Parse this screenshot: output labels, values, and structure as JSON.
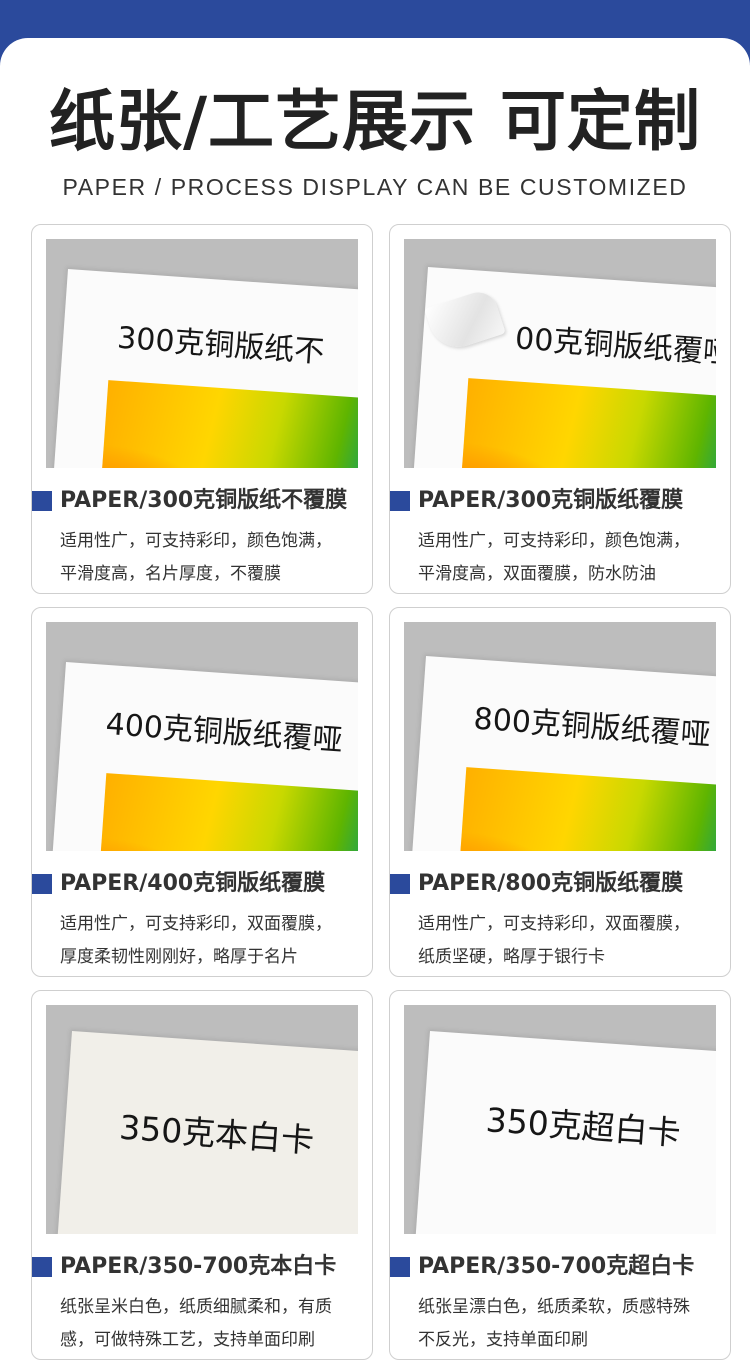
{
  "header": {
    "title": "纸张/工艺展示 可定制",
    "subtitle": "PAPER / PROCESS DISPLAY CAN BE CUSTOMIZED"
  },
  "colors": {
    "accent": "#2b4a9c"
  },
  "cards": [
    {
      "photo_text": "300克铜版纸不",
      "title": "PAPER/300克铜版纸不覆膜",
      "desc": [
        "适用性广，可支持彩印，颜色饱满，",
        "平滑度高，名片厚度，不覆膜"
      ]
    },
    {
      "photo_text": "00克铜版纸覆哑",
      "title": "PAPER/300克铜版纸覆膜",
      "desc": [
        "适用性广，可支持彩印，颜色饱满，",
        "平滑度高，双面覆膜，防水防油"
      ]
    },
    {
      "photo_text": "400克铜版纸覆哑",
      "title": "PAPER/400克铜版纸覆膜",
      "desc": [
        "适用性广，可支持彩印，双面覆膜，",
        "厚度柔韧性刚刚好，略厚于名片"
      ]
    },
    {
      "photo_text": "800克铜版纸覆哑",
      "title": "PAPER/800克铜版纸覆膜",
      "desc": [
        "适用性广，可支持彩印，双面覆膜，",
        "纸质坚硬，略厚于银行卡"
      ]
    },
    {
      "photo_text": "350克本白卡",
      "title": "PAPER/350-700克本白卡",
      "desc": [
        "纸张呈米白色，纸质细腻柔和，有质",
        "感，可做特殊工艺，支持单面印刷"
      ]
    },
    {
      "photo_text": "350克超白卡",
      "title": "PAPER/350-700克超白卡",
      "desc": [
        "纸张呈漂白色，纸质柔软，质感特殊",
        "不反光，支持单面印刷"
      ]
    }
  ]
}
